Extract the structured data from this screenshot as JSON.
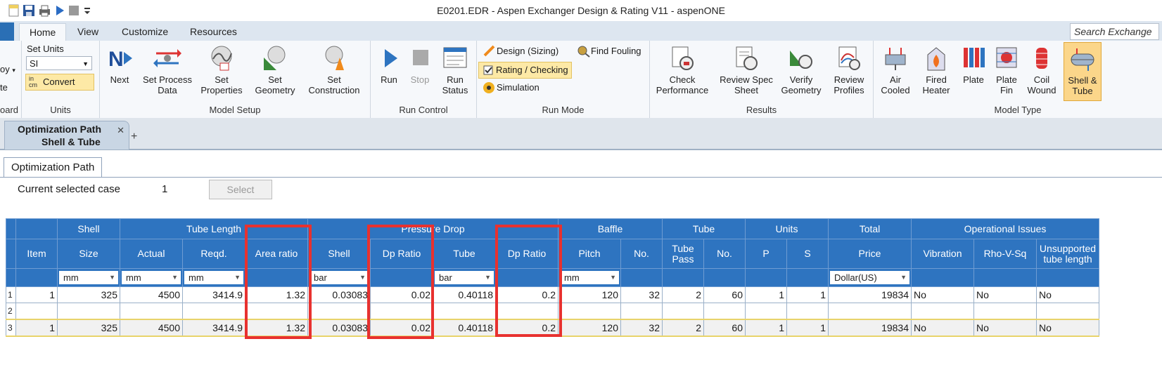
{
  "window": {
    "title": "E0201.EDR - Aspen Exchanger Design & Rating V11 - aspenONE"
  },
  "ribbon_tabs": [
    "Home",
    "View",
    "Customize",
    "Resources"
  ],
  "search_placeholder": "Search Exchange",
  "ribbon": {
    "clipped_left": {
      "item1": "oy",
      "item2": "te",
      "group": "oard"
    },
    "units": {
      "set_units_label": "Set Units",
      "select_value": "SI",
      "convert_label": "Convert",
      "convert_icon_text_top": "in",
      "convert_icon_text_bottom": "cm",
      "group": "Units"
    },
    "model_setup": {
      "next": "Next",
      "set_process_data": [
        "Set Process",
        "Data"
      ],
      "set_properties": [
        "Set",
        "Properties"
      ],
      "set_geometry": [
        "Set",
        "Geometry"
      ],
      "set_construction": [
        "Set",
        "Construction"
      ],
      "group": "Model Setup"
    },
    "run_control": {
      "run": "Run",
      "stop": "Stop",
      "run_status": [
        "Run",
        "Status"
      ],
      "group": "Run Control"
    },
    "run_mode": {
      "design": "Design (Sizing)",
      "rating": "Rating / Checking",
      "simulation": "Simulation",
      "find_fouling": "Find Fouling",
      "group": "Run Mode"
    },
    "results": {
      "check_performance": [
        "Check",
        "Performance"
      ],
      "review_spec_sheet": [
        "Review Spec",
        "Sheet"
      ],
      "verify_geometry": [
        "Verify",
        "Geometry"
      ],
      "review_profiles": [
        "Review",
        "Profiles"
      ],
      "group": "Results"
    },
    "model_type": {
      "air_cooled": [
        "Air",
        "Cooled"
      ],
      "fired_heater": [
        "Fired",
        "Heater"
      ],
      "plate": [
        "Plate"
      ],
      "plate_fin": [
        "Plate",
        "Fin"
      ],
      "coil_wound": [
        "Coil",
        "Wound"
      ],
      "shell_tube": [
        "Shell &",
        "Tube"
      ],
      "group": "Model Type"
    }
  },
  "doc_tab": {
    "line1": "Optimization Path",
    "line2": "Shell & Tube",
    "add": "+"
  },
  "subtab": "Optimization Path",
  "current_case": {
    "label": "Current selected case",
    "value": "1",
    "select_button": "Select"
  },
  "table": {
    "groups": [
      {
        "label": "",
        "span": 1
      },
      {
        "label": "Shell",
        "span": 1
      },
      {
        "label": "Tube Length",
        "span": 3
      },
      {
        "label": "Pressure Drop",
        "span": 4
      },
      {
        "label": "Baffle",
        "span": 2
      },
      {
        "label": "Tube",
        "span": 2
      },
      {
        "label": "Units",
        "span": 2
      },
      {
        "label": "Total",
        "span": 1
      },
      {
        "label": "Operational Issues",
        "span": 3
      }
    ],
    "columns": [
      "Item",
      "Size",
      "Actual",
      "Reqd.",
      "Area ratio",
      "Shell",
      "Dp Ratio",
      "Tube",
      "Dp Ratio",
      "Pitch",
      "No.",
      "Tube Pass",
      "No.",
      "P",
      "S",
      "Price",
      "Vibration",
      "Rho-V-Sq",
      "Unsupported tube length"
    ],
    "units": [
      "",
      "mm",
      "mm",
      "mm",
      "",
      "bar",
      "",
      "bar",
      "",
      "mm",
      "",
      "",
      "",
      "",
      "",
      "Dollar(US)",
      "",
      "",
      ""
    ],
    "rows": [
      {
        "rn": "1",
        "cells": [
          "1",
          "325",
          "4500",
          "3414.9",
          "1.32",
          "0.03083",
          "0.02",
          "0.40118",
          "0.2",
          "120",
          "32",
          "2",
          "60",
          "1",
          "1",
          "19834",
          "No",
          "No",
          "No"
        ]
      },
      {
        "rn": "2",
        "cells": [
          "",
          "",
          "",
          "",
          "",
          "",
          "",
          "",
          "",
          "",
          "",
          "",
          "",
          "",
          "",
          "",
          "",
          "",
          ""
        ]
      },
      {
        "rn": "3",
        "cells": [
          "1",
          "325",
          "4500",
          "3414.9",
          "1.32",
          "0.03083",
          "0.02",
          "0.40118",
          "0.2",
          "120",
          "32",
          "2",
          "60",
          "1",
          "1",
          "19834",
          "No",
          "No",
          "No"
        ]
      }
    ]
  },
  "colors": {
    "header_blue": "#2e74c0",
    "highlight": "#e8312f"
  }
}
